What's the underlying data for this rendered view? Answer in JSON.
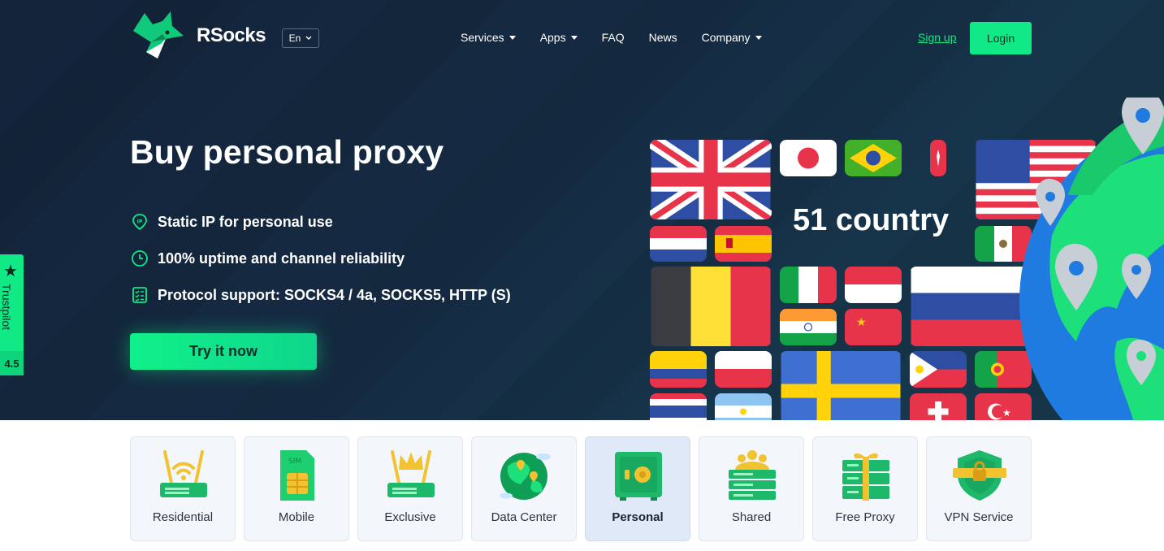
{
  "brand": {
    "name": "RSocks",
    "accent": "#11e886",
    "bg": "#13233a"
  },
  "header": {
    "language": "En",
    "nav": [
      {
        "label": "Services",
        "dropdown": true
      },
      {
        "label": "Apps",
        "dropdown": true
      },
      {
        "label": "FAQ",
        "dropdown": false
      },
      {
        "label": "News",
        "dropdown": false
      },
      {
        "label": "Company",
        "dropdown": true
      }
    ],
    "signup_label": "Sign up",
    "login_label": "Login"
  },
  "hero": {
    "title": "Buy personal proxy",
    "features": [
      {
        "icon": "ip-pin-icon",
        "text": "Static IP for personal use"
      },
      {
        "icon": "clock-icon",
        "text": "100% uptime and channel reliability"
      },
      {
        "icon": "checklist-icon",
        "text": "Protocol support: SOCKS4 / 4a, SOCKS5, HTTP (S)"
      }
    ],
    "cta_label": "Try it now",
    "country_label": "51 country"
  },
  "trustpilot": {
    "label": "Trustpilot",
    "score": "4.5"
  },
  "services": [
    {
      "label": "Residential",
      "icon": "router-wifi-icon",
      "active": false
    },
    {
      "label": "Mobile",
      "icon": "sim-card-icon",
      "active": false
    },
    {
      "label": "Exclusive",
      "icon": "router-crown-icon",
      "active": false
    },
    {
      "label": "Data Center",
      "icon": "globe-pins-icon",
      "active": false
    },
    {
      "label": "Personal",
      "icon": "safe-icon",
      "active": true
    },
    {
      "label": "Shared",
      "icon": "users-server-icon",
      "active": false
    },
    {
      "label": "Free Proxy",
      "icon": "gift-server-icon",
      "active": false
    },
    {
      "label": "VPN Service",
      "icon": "shield-lock-icon",
      "active": false
    }
  ]
}
